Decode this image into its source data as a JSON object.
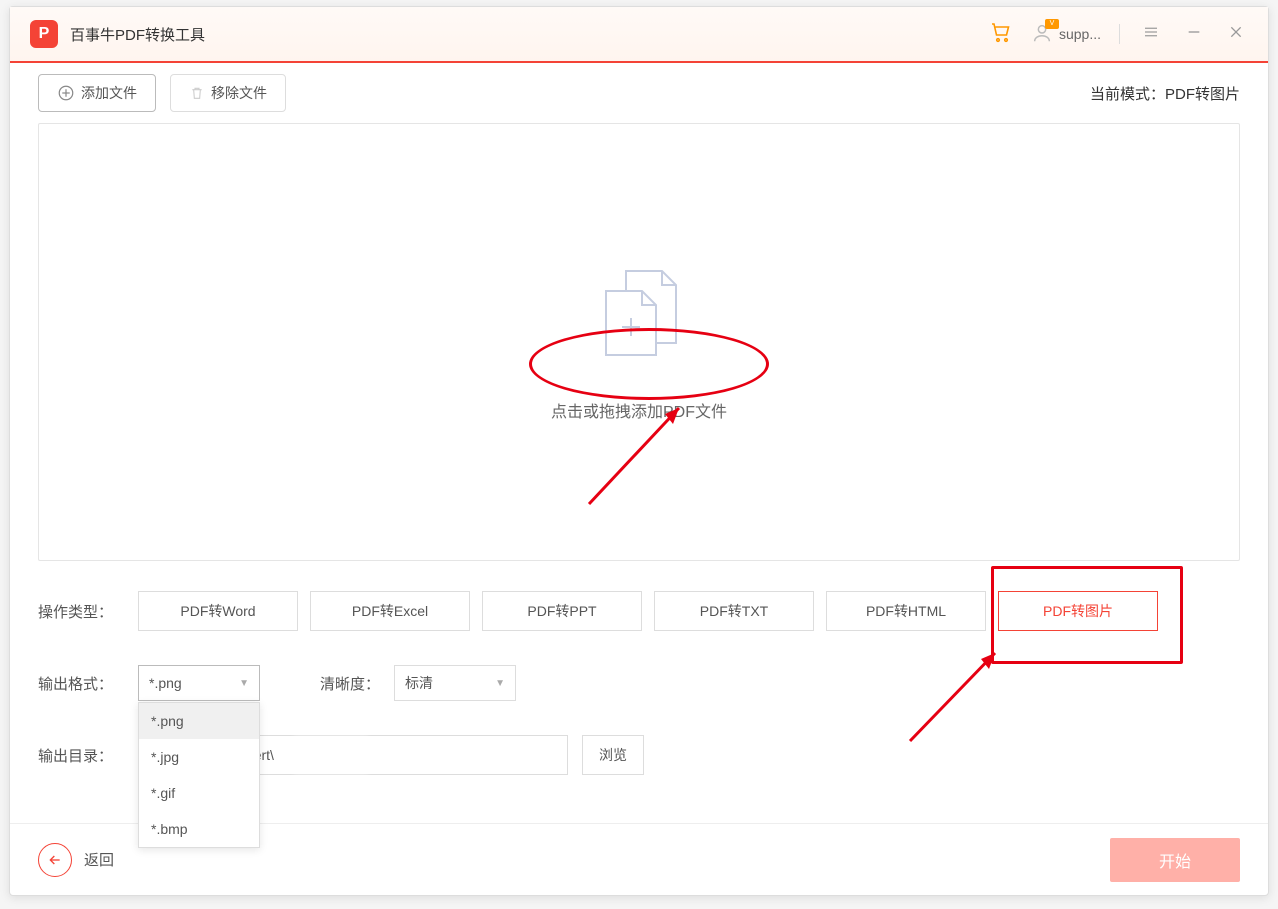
{
  "app": {
    "title": "百事牛PDF转换工具",
    "logo_letter": "P"
  },
  "titlebar": {
    "user_label": "supp..."
  },
  "toolbar": {
    "add_file": "添加文件",
    "remove_file": "移除文件",
    "mode_prefix": "当前模式：",
    "mode_value": "PDF转图片"
  },
  "dropzone": {
    "text": "点击或拖拽添加PDF文件"
  },
  "operation": {
    "label": "操作类型：",
    "buttons": [
      "PDF转Word",
      "PDF转Excel",
      "PDF转PPT",
      "PDF转TXT",
      "PDF转HTML",
      "PDF转图片"
    ],
    "active_index": 5
  },
  "output_format": {
    "label": "输出格式：",
    "selected": "*.png",
    "options": [
      "*.png",
      "*.jpg",
      "*.gif",
      "*.bmp"
    ]
  },
  "clarity": {
    "label": "清晰度：",
    "selected": "标清"
  },
  "output_dir": {
    "label": "输出目录：",
    "path": "esktop\\PDFconvert\\",
    "browse": "浏览"
  },
  "footer": {
    "back": "返回",
    "start": "开始"
  }
}
